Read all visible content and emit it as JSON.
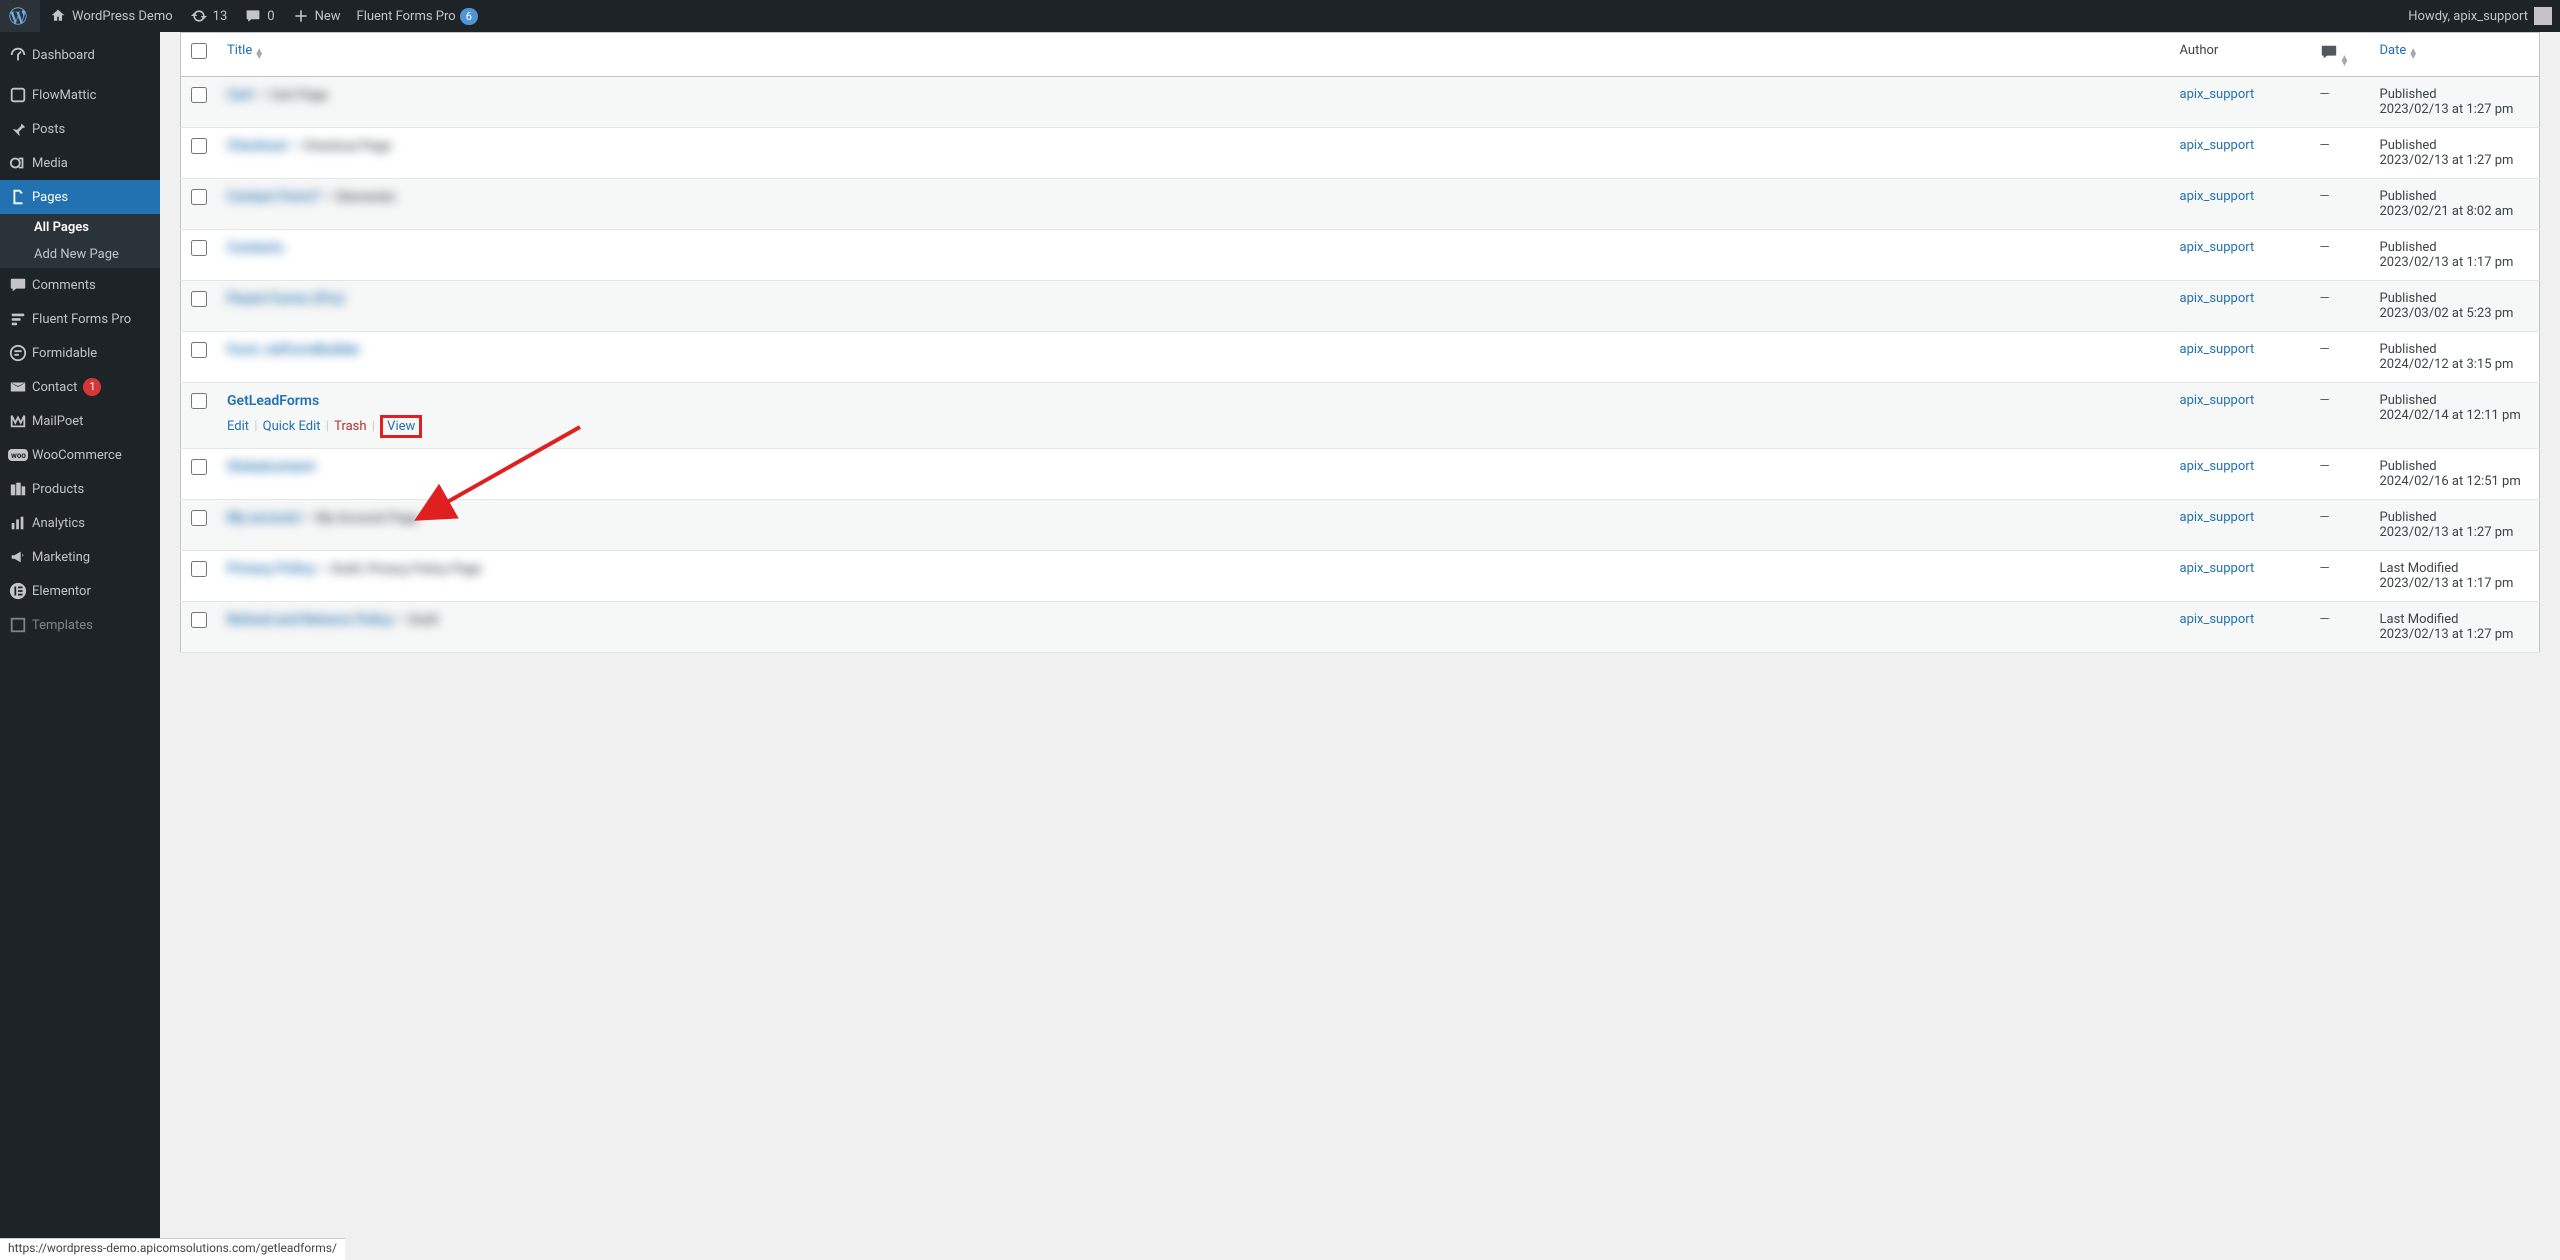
{
  "adminbar": {
    "site_name": "WordPress Demo",
    "updates_count": "13",
    "comments_count": "0",
    "new_label": "New",
    "fluent_label": "Fluent Forms Pro",
    "fluent_badge": "6",
    "howdy": "Howdy, apix_support"
  },
  "sidebar": {
    "items": [
      {
        "label": "Dashboard"
      },
      {
        "label": "FlowMattic"
      },
      {
        "label": "Posts"
      },
      {
        "label": "Media"
      },
      {
        "label": "Pages"
      },
      {
        "label": "Comments"
      },
      {
        "label": "Fluent Forms Pro"
      },
      {
        "label": "Formidable"
      },
      {
        "label": "Contact",
        "badge": "1"
      },
      {
        "label": "MailPoet"
      },
      {
        "label": "WooCommerce"
      },
      {
        "label": "Products"
      },
      {
        "label": "Analytics"
      },
      {
        "label": "Marketing"
      },
      {
        "label": "Elementor"
      },
      {
        "label": "Templates"
      }
    ],
    "submenu_pages": {
      "all_pages": "All Pages",
      "add_new": "Add New Page"
    }
  },
  "table": {
    "head": {
      "title": "Title",
      "author": "Author",
      "date": "Date"
    },
    "rows": [
      {
        "title": "Cart",
        "state": "Cart Page",
        "author": "apix_support",
        "comments": "—",
        "date_label": "Published",
        "date_val": "2023/02/13 at 1:27 pm",
        "blurred": true,
        "alt": true
      },
      {
        "title": "Checkout",
        "state": "Checkout Page",
        "author": "apix_support",
        "comments": "—",
        "date_label": "Published",
        "date_val": "2023/02/13 at 1:27 pm",
        "blurred": true,
        "alt": false
      },
      {
        "title": "Contact Form7",
        "state": "Elementor",
        "author": "apix_support",
        "comments": "—",
        "date_label": "Published",
        "date_val": "2023/02/21 at 8:02 am",
        "blurred": true,
        "alt": true
      },
      {
        "title": "Contacts",
        "state": "",
        "author": "apix_support",
        "comments": "—",
        "date_label": "Published",
        "date_val": "2023/02/13 at 1:17 pm",
        "blurred": true,
        "alt": false
      },
      {
        "title": "Fluent Forms (Pro)",
        "state": "",
        "author": "apix_support",
        "comments": "—",
        "date_label": "Published",
        "date_val": "2023/03/02 at 5:23 pm",
        "blurred": true,
        "alt": true
      },
      {
        "title": "Form JetFormBuilder",
        "state": "",
        "author": "apix_support",
        "comments": "—",
        "date_label": "Published",
        "date_val": "2024/02/12 at 3:15 pm",
        "blurred": true,
        "alt": false
      },
      {
        "title": "GetLeadForms",
        "state": "",
        "author": "apix_support",
        "comments": "—",
        "date_label": "Published",
        "date_val": "2024/02/14 at 12:11 pm",
        "blurred": false,
        "alt": true,
        "show_actions": true
      },
      {
        "title": "Globalcontent",
        "state": "",
        "author": "apix_support",
        "comments": "—",
        "date_label": "Published",
        "date_val": "2024/02/16 at 12:51 pm",
        "blurred": true,
        "alt": false
      },
      {
        "title": "My account",
        "state": "My Account Page",
        "author": "apix_support",
        "comments": "—",
        "date_label": "Published",
        "date_val": "2023/02/13 at 1:27 pm",
        "blurred": true,
        "alt": true
      },
      {
        "title": "Privacy Policy",
        "state": "Draft, Privacy Policy Page",
        "author": "apix_support",
        "comments": "—",
        "date_label": "Last Modified",
        "date_val": "2023/02/13 at 1:17 pm",
        "blurred": true,
        "alt": false
      },
      {
        "title": "Refund and Returns Policy",
        "state": "Draft",
        "author": "apix_support",
        "comments": "—",
        "date_label": "Last Modified",
        "date_val": "2023/02/13 at 1:27 pm",
        "blurred": true,
        "alt": true
      }
    ],
    "row_actions": {
      "edit": "Edit",
      "quick_edit": "Quick Edit",
      "trash": "Trash",
      "view": "View"
    }
  },
  "statusbar": {
    "url": "https://wordpress-demo.apicomsolutions.com/getleadforms/"
  }
}
